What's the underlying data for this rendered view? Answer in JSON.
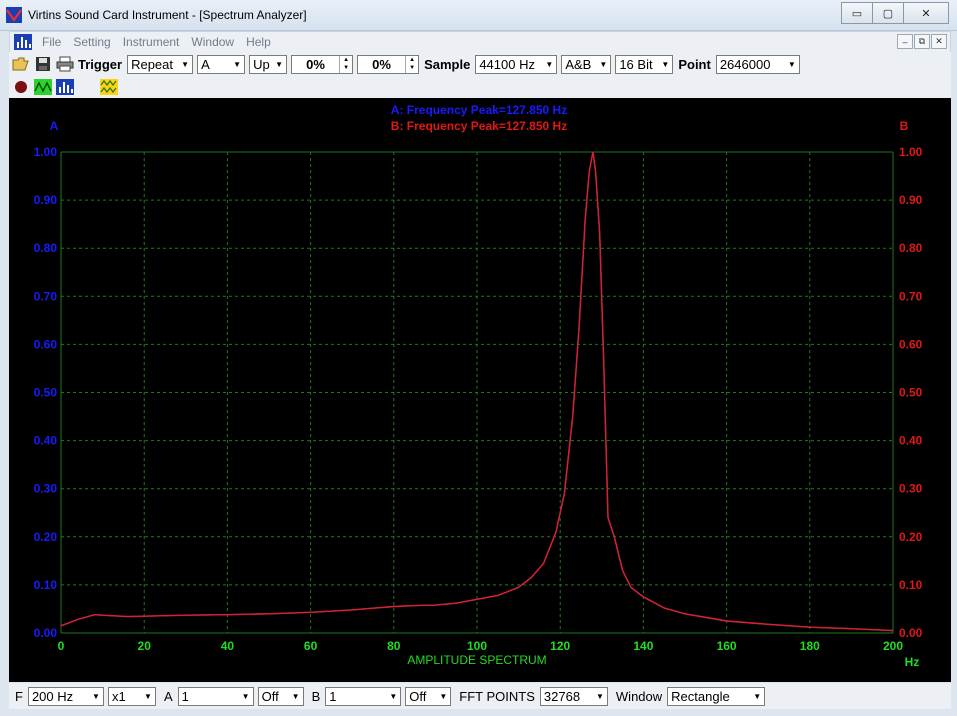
{
  "window": {
    "title": "Virtins Sound Card Instrument - [Spectrum Analyzer]",
    "minimize_glyph": "▭",
    "maximize_glyph": "▢",
    "close_glyph": "✕",
    "mdi_minimize": "–",
    "mdi_restore": "⧉",
    "mdi_close": "✕"
  },
  "menu": {
    "items": [
      "File",
      "Setting",
      "Instrument",
      "Window",
      "Help"
    ]
  },
  "toolbar": {
    "trigger_label": "Trigger",
    "trigger_mode": "Repeat",
    "trigger_channel": "A",
    "trigger_edge": "Up",
    "trigger_level_1": "0%",
    "trigger_level_2": "0%",
    "sample_label": "Sample",
    "sample_rate": "44100 Hz",
    "channels": "A&B",
    "bit_depth": "16 Bit",
    "point_label": "Point",
    "point_value": "2646000"
  },
  "bottom": {
    "f_label": "F",
    "f_value": "200 Hz",
    "zoom": "x1",
    "a_label": "A",
    "a_value": "1",
    "a_state": "Off",
    "b_label": "B",
    "b_value": "1",
    "b_state": "Off",
    "fft_label": "FFT POINTS",
    "fft_value": "32768",
    "window_label": "Window",
    "window_value": "Rectangle"
  },
  "colors": {
    "grid": "#1f7a1f",
    "axis_text_left": "#1a1aff",
    "axis_text_right": "#e01818",
    "axis_text_x": "#22dd22",
    "series_a": "#3a3aff",
    "series_b": "#e02020",
    "background": "#000000"
  },
  "chart_data": {
    "type": "line",
    "title": "AMPLITUDE SPECTRUM",
    "annotations": [
      "A: Frequency Peak=127.850 Hz",
      "B: Frequency Peak=127.850 Hz"
    ],
    "left_axis_label": "A",
    "right_axis_label": "B",
    "x_unit": "Hz",
    "xlim": [
      0,
      200
    ],
    "ylim": [
      0,
      1
    ],
    "x_ticks": [
      "0",
      "20",
      "40",
      "60",
      "80",
      "100",
      "120",
      "140",
      "160",
      "180",
      "200"
    ],
    "y_ticks": [
      "0.00",
      "0.10",
      "0.20",
      "0.30",
      "0.40",
      "0.50",
      "0.60",
      "0.70",
      "0.80",
      "0.90",
      "1.00"
    ],
    "grid": true,
    "series": [
      {
        "name": "A",
        "x": [
          0,
          4,
          8,
          12,
          16,
          20,
          30,
          40,
          50,
          60,
          70,
          80,
          85,
          90,
          95,
          100,
          105,
          110,
          113,
          116,
          119,
          121,
          123,
          124.5,
          126,
          127,
          127.85,
          128.5,
          129.5,
          130.5,
          131.5,
          133,
          135,
          137,
          140,
          145,
          150,
          160,
          170,
          180,
          190,
          200
        ],
        "y": [
          0.015,
          0.028,
          0.038,
          0.036,
          0.034,
          0.035,
          0.037,
          0.038,
          0.04,
          0.043,
          0.048,
          0.055,
          0.057,
          0.058,
          0.062,
          0.07,
          0.078,
          0.095,
          0.115,
          0.145,
          0.21,
          0.29,
          0.45,
          0.63,
          0.86,
          0.96,
          1.0,
          0.96,
          0.83,
          0.55,
          0.24,
          0.2,
          0.13,
          0.095,
          0.075,
          0.052,
          0.04,
          0.025,
          0.018,
          0.012,
          0.009,
          0.005
        ]
      },
      {
        "name": "B",
        "x": [
          0,
          4,
          8,
          12,
          16,
          20,
          30,
          40,
          50,
          60,
          70,
          80,
          85,
          90,
          95,
          100,
          105,
          110,
          113,
          116,
          119,
          121,
          123,
          124.5,
          126,
          127,
          127.85,
          128.5,
          129.5,
          130.5,
          131.5,
          133,
          135,
          137,
          140,
          145,
          150,
          160,
          170,
          180,
          190,
          200
        ],
        "y": [
          0.015,
          0.028,
          0.038,
          0.036,
          0.034,
          0.035,
          0.037,
          0.038,
          0.04,
          0.043,
          0.048,
          0.055,
          0.057,
          0.058,
          0.062,
          0.07,
          0.078,
          0.095,
          0.115,
          0.145,
          0.21,
          0.29,
          0.45,
          0.63,
          0.86,
          0.96,
          1.0,
          0.96,
          0.83,
          0.55,
          0.24,
          0.2,
          0.13,
          0.095,
          0.075,
          0.052,
          0.04,
          0.025,
          0.018,
          0.012,
          0.009,
          0.005
        ]
      }
    ]
  }
}
